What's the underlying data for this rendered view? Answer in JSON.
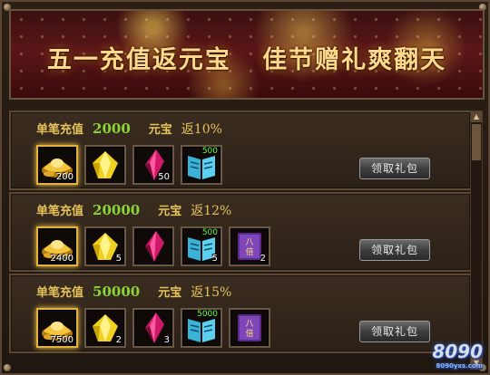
{
  "banner": {
    "title": "五一充值返元宝   佳节赠礼爽翻天"
  },
  "tiers": [
    {
      "label": "单笔充值",
      "amount": "2000",
      "currency": "元宝",
      "return": "返10%",
      "items": [
        {
          "icon": "gold-ingot-icon",
          "qty": "200",
          "badge": "",
          "highlight": true
        },
        {
          "icon": "yellow-gem-icon",
          "qty": "",
          "badge": "",
          "highlight": false
        },
        {
          "icon": "red-crystal-icon",
          "qty": "50",
          "badge": "",
          "highlight": false
        },
        {
          "icon": "blue-book-icon",
          "qty": "",
          "badge": "500",
          "highlight": false
        }
      ],
      "claim_label": "领取礼包"
    },
    {
      "label": "单笔充值",
      "amount": "20000",
      "currency": "元宝",
      "return": "返12%",
      "items": [
        {
          "icon": "gold-ingot-icon",
          "qty": "2400",
          "badge": "",
          "highlight": true
        },
        {
          "icon": "yellow-gem-icon",
          "qty": "5",
          "badge": "",
          "highlight": false
        },
        {
          "icon": "red-crystal-icon",
          "qty": "",
          "badge": "",
          "highlight": false
        },
        {
          "icon": "blue-book-icon",
          "qty": "5",
          "badge": "500",
          "highlight": false
        },
        {
          "icon": "purple-scroll-icon",
          "qty": "2",
          "badge": "",
          "highlight": false
        }
      ],
      "claim_label": "领取礼包"
    },
    {
      "label": "单笔充值",
      "amount": "50000",
      "currency": "元宝",
      "return": "返15%",
      "items": [
        {
          "icon": "gold-ingot-icon",
          "qty": "7500",
          "badge": "",
          "highlight": true
        },
        {
          "icon": "yellow-gem-icon",
          "qty": "2",
          "badge": "",
          "highlight": false
        },
        {
          "icon": "red-crystal-icon",
          "qty": "3",
          "badge": "",
          "highlight": false
        },
        {
          "icon": "blue-book-icon",
          "qty": "",
          "badge": "5000",
          "highlight": false
        },
        {
          "icon": "purple-scroll-icon",
          "qty": "",
          "badge": "",
          "highlight": false
        }
      ],
      "claim_label": "领取礼包"
    }
  ],
  "watermark": {
    "text": "8090",
    "sub": "8090yxs.com"
  }
}
